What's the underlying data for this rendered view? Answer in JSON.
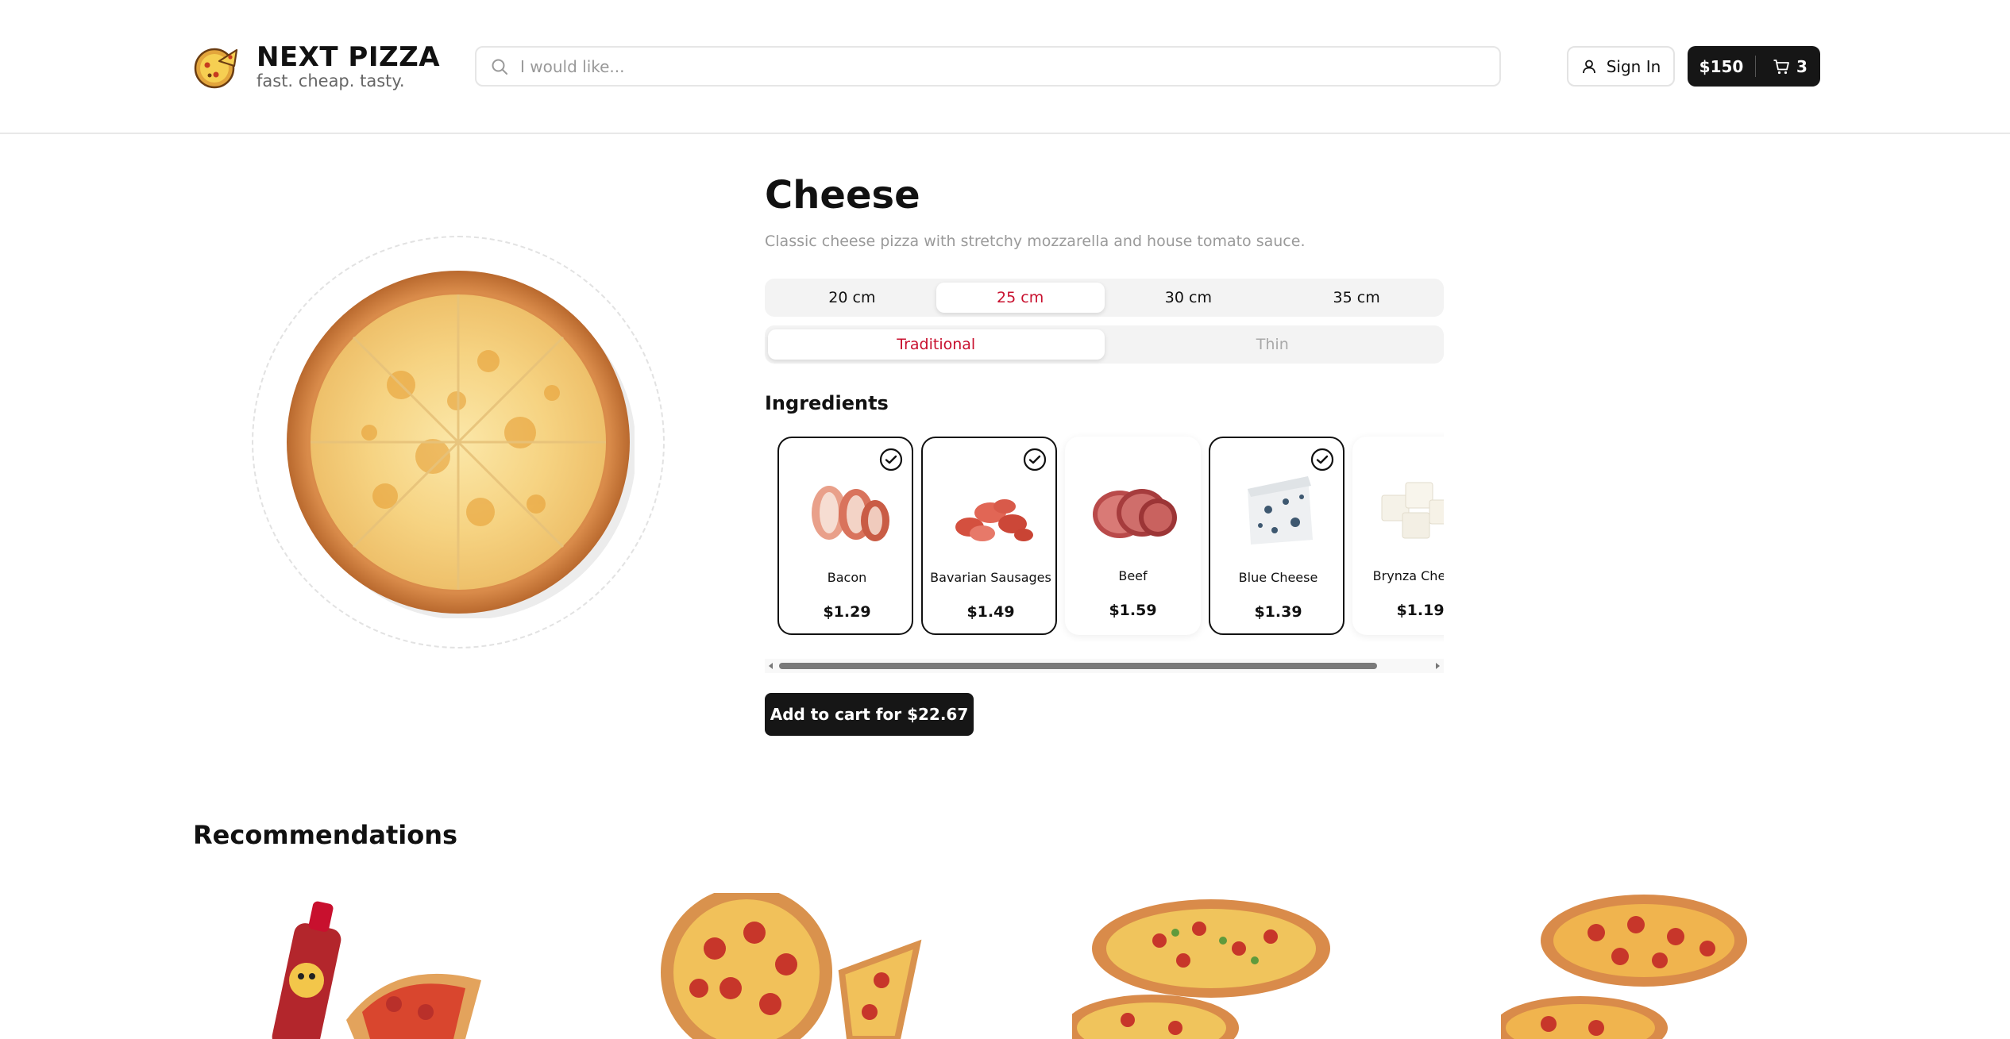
{
  "brand": {
    "title": "NEXT PIZZA",
    "tagline": "fast. cheap. tasty."
  },
  "search": {
    "placeholder": "I would like..."
  },
  "header": {
    "signin_label": "Sign In",
    "cart_total": "$150",
    "cart_count": "3"
  },
  "product": {
    "title": "Cheese",
    "description": "Classic cheese pizza with stretchy mozzarella and house tomato sauce.",
    "sizes": [
      {
        "label": "20 cm",
        "active": false
      },
      {
        "label": "25 cm",
        "active": true
      },
      {
        "label": "30 cm",
        "active": false
      },
      {
        "label": "35 cm",
        "active": false
      }
    ],
    "types": [
      {
        "label": "Traditional",
        "active": true
      },
      {
        "label": "Thin",
        "active": false
      }
    ],
    "ingredients_title": "Ingredients",
    "ingredients": [
      {
        "name": "Bacon",
        "price": "$1.29",
        "selected": true
      },
      {
        "name": "Bavarian Sausages",
        "price": "$1.49",
        "selected": true
      },
      {
        "name": "Beef",
        "price": "$1.59",
        "selected": false
      },
      {
        "name": "Blue Cheese",
        "price": "$1.39",
        "selected": true
      },
      {
        "name": "Brynza Cheese",
        "price": "$1.19",
        "selected": false
      }
    ],
    "add_to_cart_label": "Add to cart for $22.67"
  },
  "recommendations": {
    "title": "Recommendations"
  },
  "colors": {
    "accent": "#c8102e",
    "dark": "#161616"
  }
}
